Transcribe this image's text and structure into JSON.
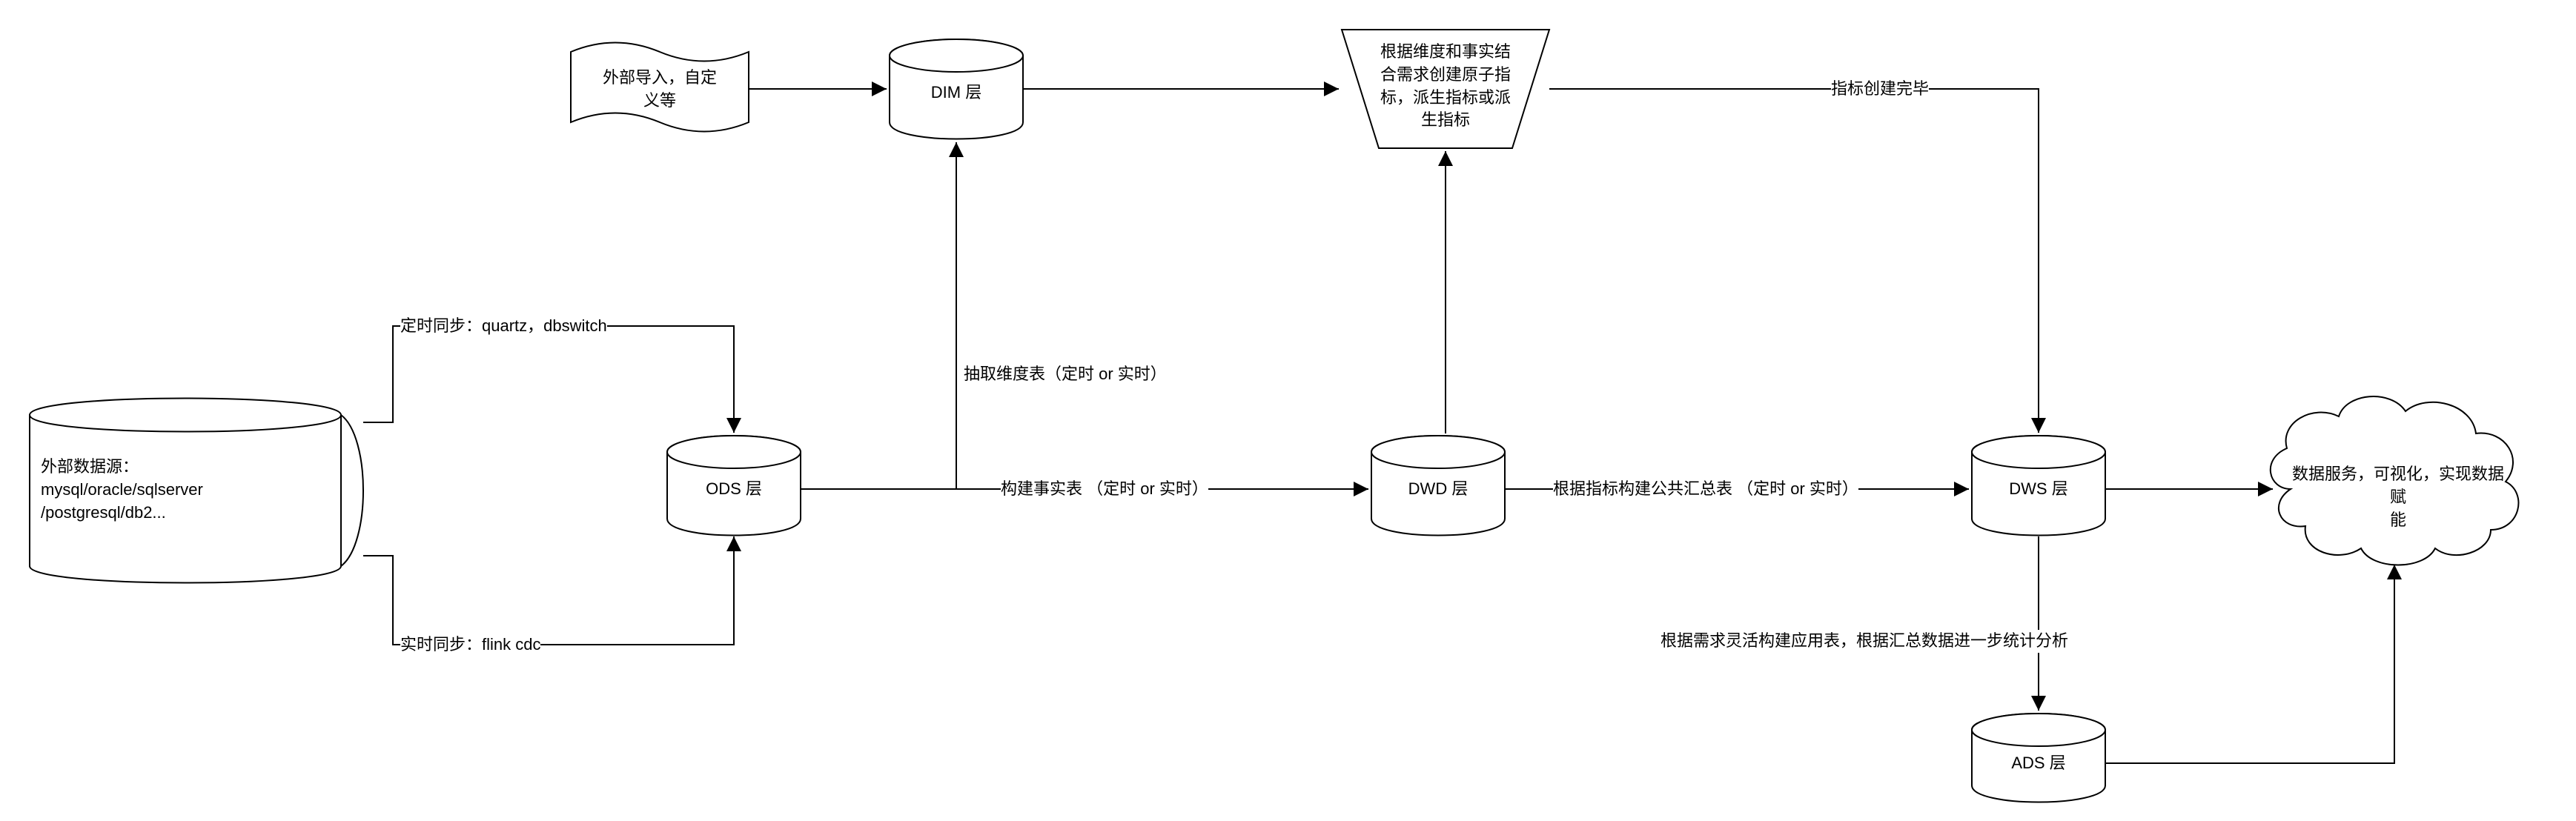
{
  "nodes": {
    "datasource": "外部数据源：\nmysql/oracle/sqlserver\n/postgresql/db2...",
    "external_import": "外部导入，自定\n义等",
    "ods": "ODS 层",
    "dim": "DIM 层",
    "dwd": "DWD 层",
    "metrics": "根据维度和事实结\n合需求创建原子指\n标，派生指标或派\n生指标",
    "dws": "DWS 层",
    "ads": "ADS 层",
    "cloud": "数据服务，可视化，实现数据赋\n能"
  },
  "edges": {
    "sync_scheduled": "定时同步：quartz，dbswitch",
    "sync_realtime": "实时同步：flink cdc",
    "extract_dim": "抽取维度表（定时 or 实时）",
    "build_fact": "构建事实表 （定时 or 实时）",
    "build_summary": "根据指标构建公共汇总表 （定时 or 实时）",
    "metrics_done": "指标创建完毕",
    "build_app": "根据需求灵活构建应用表，根据汇总数据进一步统计分析"
  }
}
